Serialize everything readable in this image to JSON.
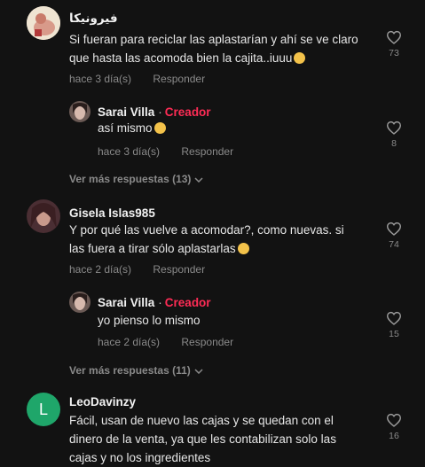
{
  "comments": [
    {
      "username": "فيرونيكا",
      "lines": [
        "Si fueran para reciclar las aplastarían y ahí se ve claro",
        "que hasta las acomoda bien la cajita..iuuu"
      ],
      "time": "hace 3 día(s)",
      "reply_label": "Responder",
      "likes": "73",
      "reply": {
        "username": "Sarai Villa",
        "separator": "·",
        "badge": "Creador",
        "text": "así mismo",
        "time": "hace 3 día(s)",
        "reply_label": "Responder",
        "likes": "8"
      },
      "more_replies": "Ver más respuestas (13)"
    },
    {
      "username": "Gisela Islas985",
      "lines": [
        "Y por qué las vuelve a acomodar?, como nuevas. si",
        "las fuera a tirar sólo aplastarlas"
      ],
      "time": "hace 2 día(s)",
      "reply_label": "Responder",
      "likes": "74",
      "reply": {
        "username": "Sarai Villa",
        "separator": "·",
        "badge": "Creador",
        "text": "yo pienso lo mismo",
        "time": "hace 2 día(s)",
        "reply_label": "Responder",
        "likes": "15"
      },
      "more_replies": "Ver más respuestas (11)"
    },
    {
      "username": "LeoDavinzy",
      "avatar_letter": "L",
      "lines": [
        "Fácil, usan de nuevo las cajas y se quedan con el",
        "dinero de la venta, ya que les contabilizan solo las",
        "cajas y no los ingredientes"
      ],
      "likes": "16"
    }
  ],
  "colors": {
    "background": "#121212",
    "creator_badge": "#fe2c55",
    "avatar_l": "#1fa66a"
  },
  "icons": {
    "like": "heart-outline-icon",
    "expand": "chevron-down-icon",
    "emoji": "emoji-icon"
  }
}
